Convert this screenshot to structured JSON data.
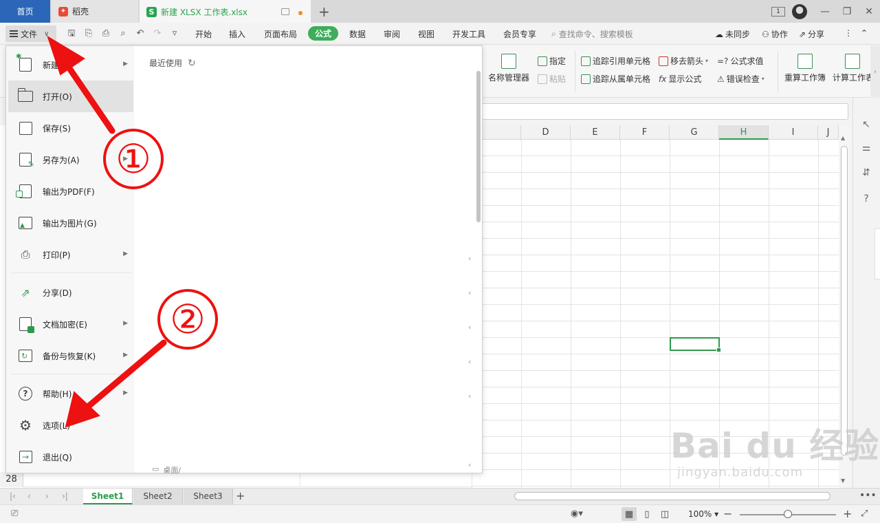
{
  "tabs": {
    "home": "首页",
    "daoke": "稻壳",
    "document": "新建 XLSX 工作表.xlsx",
    "document_icon": "S"
  },
  "window": {
    "page_badge": "1"
  },
  "menubar": {
    "file_label": "文件",
    "items": [
      "开始",
      "插入",
      "页面布局",
      "公式",
      "数据",
      "审阅",
      "视图",
      "开发工具",
      "会员专享"
    ],
    "active_item": "公式",
    "search_placeholder": "查找命令、搜索模板",
    "sync": "未同步",
    "collab": "协作",
    "share": "分享"
  },
  "ribbon": {
    "name_manager": "名称管理器",
    "designate": "指定",
    "paste": "粘贴",
    "trace_precedents": "追踪引用单元格",
    "trace_dependents": "追踪从属单元格",
    "remove_arrows": "移去箭头",
    "show_formulas": "显示公式",
    "evaluate_formula": "公式求值",
    "error_check": "错误检查",
    "recalc_workbook": "重算工作簿",
    "calc_sheet": "计算工作表"
  },
  "grid": {
    "columns": [
      "D",
      "E",
      "F",
      "G",
      "H",
      "I",
      "J"
    ],
    "selected_column": "H",
    "visible_row": "28"
  },
  "file_menu": {
    "items": [
      {
        "label": "新建(N)",
        "icon": "new-doc-icon",
        "sub": true
      },
      {
        "label": "打开(O)",
        "icon": "folder-open-icon",
        "sub": false
      },
      {
        "label": "保存(S)",
        "icon": "save-icon",
        "sub": false
      },
      {
        "label": "另存为(A)",
        "icon": "save-as-icon",
        "sub": true
      },
      {
        "label": "输出为PDF(F)",
        "icon": "pdf-icon",
        "sub": false
      },
      {
        "label": "输出为图片(G)",
        "icon": "image-icon",
        "sub": false
      },
      {
        "label": "打印(P)",
        "icon": "printer-icon",
        "sub": true
      },
      {
        "label": "分享(D)",
        "icon": "share-icon",
        "sub": false
      },
      {
        "label": "文档加密(E)",
        "icon": "lock-doc-icon",
        "sub": true
      },
      {
        "label": "备份与恢复(K)",
        "icon": "backup-icon",
        "sub": true
      },
      {
        "label": "帮助(H)",
        "icon": "help-icon",
        "sub": true
      },
      {
        "label": "选项(L)",
        "icon": "settings-icon",
        "sub": false
      },
      {
        "label": "退出(Q)",
        "icon": "exit-icon",
        "sub": false
      }
    ],
    "recent_title": "最近使用",
    "desktop_path": "桌面/"
  },
  "sheets": [
    "Sheet1",
    "Sheet2",
    "Sheet3"
  ],
  "active_sheet": "Sheet1",
  "statusbar": {
    "zoom": "100%"
  },
  "annotations": {
    "step1": "①",
    "step2": "②"
  },
  "watermark": {
    "main": "Bai du 经验",
    "url": "jingyan.baidu.com"
  },
  "colors": {
    "accent_green": "#2d9a4b",
    "home_tab_blue": "#2c66b8",
    "annotation_red": "#e11111"
  }
}
